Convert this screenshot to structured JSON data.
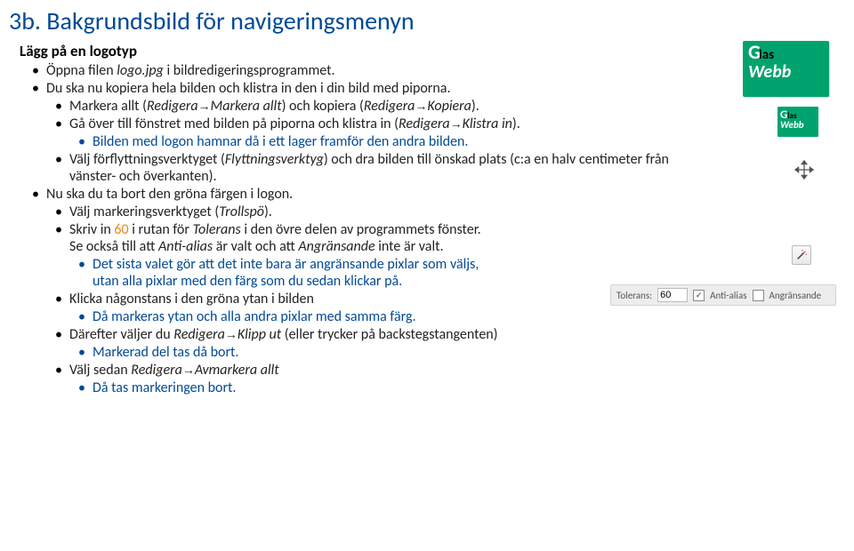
{
  "title": "3b. Bakgrundsbild för navigeringsmenyn",
  "subtitle": "Lägg på en logotyp",
  "items": {
    "l1_1a": "Öppna filen ",
    "l1_1b": "logo.jpg",
    "l1_1c": " i bildredigeringsprogrammet.",
    "l1_2": "Du ska nu kopiera hela bilden och klistra in den i din bild med piporna.",
    "l2_1a": "Markera allt (",
    "l2_1b": "Redigera",
    "arrow": "→",
    "l2_1c": "Markera allt",
    "l2_1d": ") och kopiera (",
    "l2_1e": "Redigera",
    "l2_1f": "Kopiera",
    "l2_1g": ").",
    "l2_2a": "Gå över till fönstret med bilden på piporna och klistra in (",
    "l2_2b": "Redigera",
    "l2_2c": "Klistra in",
    "l2_2d": ").",
    "l3_1": "Bilden med logon hamnar då i ett lager framför den andra bilden.",
    "l2_3a": "Välj förflyttningsverktyget (",
    "l2_3b": "Flyttningsverktyg",
    "l2_3c": ") och dra bilden till önskad plats (c:a en halv centimeter från vänster- och överkanten).",
    "l1_3": "Nu ska du ta bort den gröna färgen i logon.",
    "l2_4a": "Välj markeringsverktyget (",
    "l2_4b": "Trollspö",
    "l2_4c": ").",
    "l2_5a": "Skriv in ",
    "sixty": "60",
    "l2_5b": " i rutan för ",
    "l2_5c": "Tolerans",
    "l2_5d": " i den övre delen av programmets fönster.",
    "l2_5e": "Se också till att ",
    "l2_5f": "Anti-alias",
    "l2_5g": " är valt och att ",
    "l2_5h": "Angränsande",
    "l2_5i": " inte är valt.",
    "l3_2a": "Det sista valet gör att det inte bara är angränsande pixlar som väljs,",
    "l3_2b": "utan alla pixlar med den färg som du sedan klickar på.",
    "l2_6": "Klicka någonstans i den gröna ytan i bilden",
    "l3_3": "Då markeras ytan och alla andra pixlar med samma färg.",
    "l2_7a": "Därefter väljer du ",
    "l2_7b": "Redigera",
    "l2_7c": "Klipp ut",
    "l2_7d": " (eller trycker på backstegstangenten)",
    "l3_4": "Markerad del tas då bort.",
    "l2_8a": "Välj sedan ",
    "l2_8b": "Redigera",
    "l2_8c": "Avmarkera allt",
    "l3_5": "Då tas markeringen bort."
  },
  "logo": {
    "g": "G",
    "las": "las",
    "webb": "Webb"
  },
  "toolbar": {
    "tolerans_label": "Tolerans:",
    "tolerans_value": "60",
    "antialias": "Anti-alias",
    "angr": "Angränsande",
    "check": "✓"
  }
}
